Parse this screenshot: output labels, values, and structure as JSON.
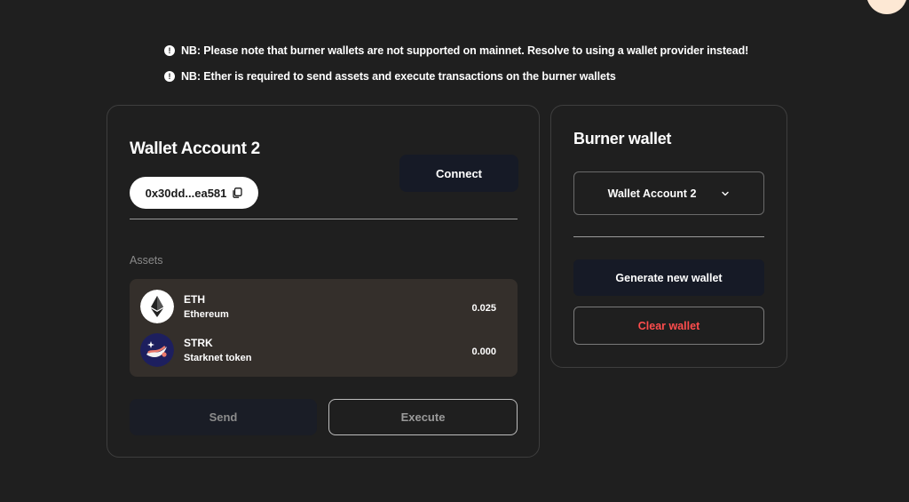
{
  "notes": [
    {
      "icon": "exclamation-icon",
      "text": "NB: Please note that burner wallets are not supported on mainnet. Resolve to using a wallet provider instead!"
    },
    {
      "icon": "exclamation-icon",
      "text": "NB: Ether is required to send assets and execute transactions on the burner wallets"
    }
  ],
  "wallet": {
    "title": "Wallet Account 2",
    "address": "0x30dd...ea581",
    "connect_label": "Connect",
    "assets_label": "Assets",
    "assets": [
      {
        "symbol": "ETH",
        "name": "Ethereum",
        "value": "0.025",
        "icon": "ethereum-icon"
      },
      {
        "symbol": "STRK",
        "name": "Starknet token",
        "value": "0.000",
        "icon": "starknet-icon"
      }
    ],
    "send_label": "Send",
    "execute_label": "Execute"
  },
  "burner": {
    "title": "Burner wallet",
    "selected_wallet": "Wallet Account 2",
    "generate_label": "Generate new wallet",
    "clear_label": "Clear wallet"
  },
  "colors": {
    "background": "#1f1f1f",
    "dark_button": "#161a26",
    "assets_panel": "#342f2b",
    "danger": "#ff4d4d"
  }
}
